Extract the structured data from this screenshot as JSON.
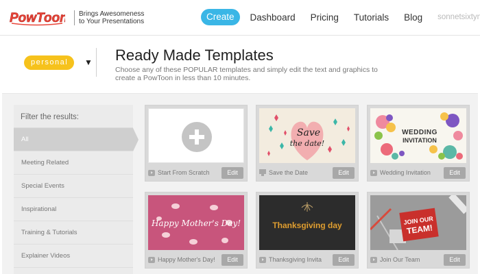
{
  "header": {
    "logo_text": "PowToon",
    "tagline_line1": "Brings Awesomeness",
    "tagline_line2": "to Your Presentations",
    "nav": {
      "create": "Create",
      "dashboard": "Dashboard",
      "pricing": "Pricing",
      "tutorials": "Tutorials",
      "blog": "Blog",
      "user": "sonnetsixtynine"
    }
  },
  "plan": {
    "label": "personal"
  },
  "page": {
    "title": "Ready Made Templates",
    "description": "Choose any of these POPULAR templates and simply edit the text and graphics to create a PowToon in less than 10 minutes."
  },
  "sidebar": {
    "title": "Filter the results:",
    "items": [
      {
        "label": "All"
      },
      {
        "label": "Meeting Related"
      },
      {
        "label": "Special Events"
      },
      {
        "label": "Inspirational"
      },
      {
        "label": "Training & Tutorials"
      },
      {
        "label": "Explainer Videos"
      }
    ]
  },
  "templates": [
    {
      "label": "Start From Scratch",
      "edit": "Edit",
      "icon": "play-icon"
    },
    {
      "label": "Save the Date",
      "edit": "Edit",
      "icon": "monitor-icon",
      "thumb_text_1": "Save",
      "thumb_text_2": "the date!"
    },
    {
      "label": "Wedding Invitation",
      "edit": "Edit",
      "icon": "play-icon",
      "thumb_text_1": "WEDDING",
      "thumb_text_2": "INVITATION"
    },
    {
      "label": "Happy Mother's Day!",
      "edit": "Edit",
      "icon": "play-icon",
      "thumb_text_1": "Happy Mother's Day!"
    },
    {
      "label": "Thanksgiving Invita",
      "edit": "Edit",
      "icon": "play-icon",
      "thumb_text_1": "Thanksgiving day"
    },
    {
      "label": "Join Our Team",
      "edit": "Edit",
      "icon": "play-icon",
      "thumb_text_1": "JOIN OUR",
      "thumb_text_2": "TEAM!"
    }
  ],
  "colors": {
    "accent": "#3ab6e6",
    "plan_badge": "#f6c21c",
    "logo_red": "#e8463a"
  }
}
